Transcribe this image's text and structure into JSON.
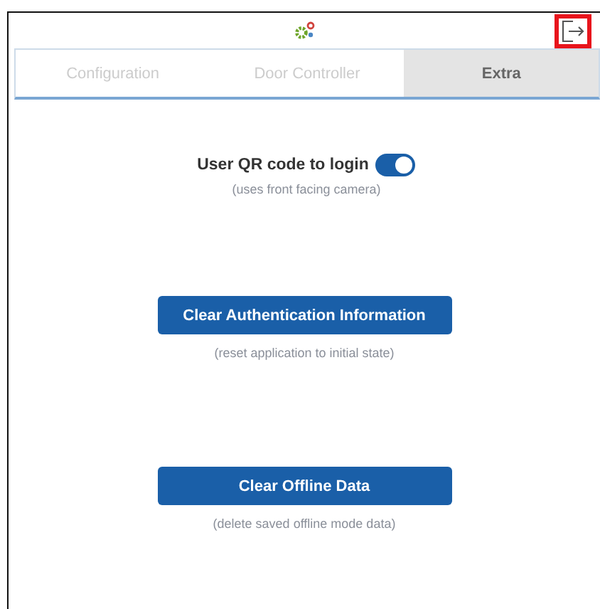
{
  "header": {
    "logout_highlighted": true
  },
  "tabs": [
    {
      "label": "Configuration",
      "selected": false
    },
    {
      "label": "Door Controller",
      "selected": false
    },
    {
      "label": "Extra",
      "selected": true
    }
  ],
  "qr_login": {
    "label": "User QR code to login",
    "on": true,
    "hint": "(uses front facing camera)"
  },
  "actions": [
    {
      "label": "Clear Authentication Information",
      "hint": "(reset application to initial state)"
    },
    {
      "label": "Clear Offline Data",
      "hint": "(delete saved offline mode data)"
    }
  ]
}
